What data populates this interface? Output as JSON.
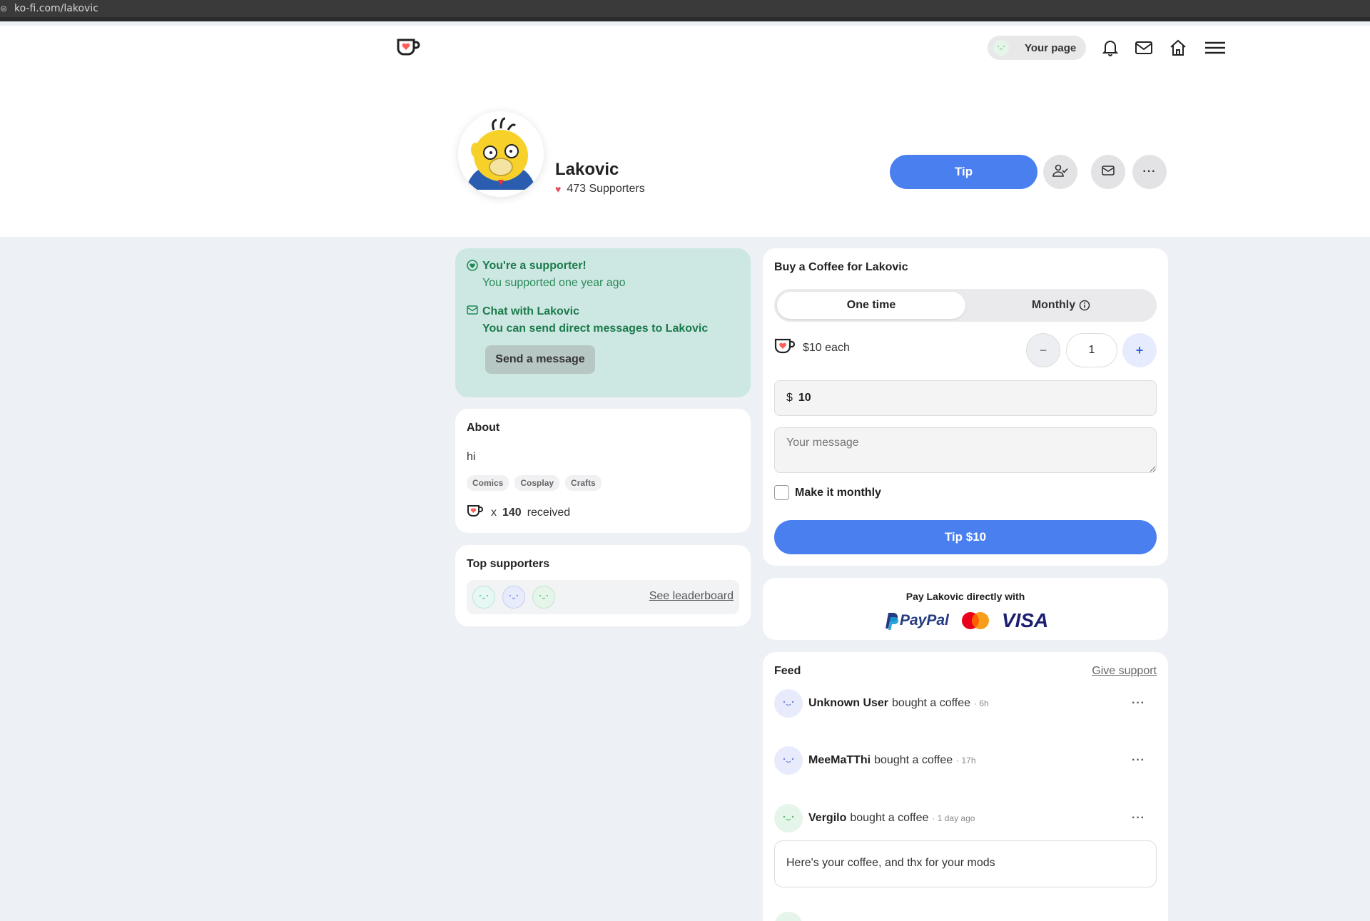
{
  "browser": {
    "url": "ko-fi.com/lakovic"
  },
  "nav": {
    "your_page": "Your page"
  },
  "profile": {
    "name": "Lakovic",
    "supporters": "473 Supporters",
    "tip_label": "Tip"
  },
  "supporter_card": {
    "title": "You're a supporter!",
    "subtitle": "You supported one year ago",
    "chat_title": "Chat with Lakovic",
    "chat_subtitle": "You can send direct messages to Lakovic",
    "send_button": "Send a message"
  },
  "about": {
    "title": "About",
    "text": "hi",
    "tags": [
      "Comics",
      "Cosplay",
      "Crafts"
    ],
    "received_x": "x",
    "received_count": "140",
    "received_label": "received"
  },
  "top_supporters": {
    "title": "Top supporters",
    "leaderboard_link": "See leaderboard"
  },
  "buy": {
    "title": "Buy a Coffee for Lakovic",
    "tab_one_time": "One time",
    "tab_monthly": "Monthly",
    "price_each": "$10 each",
    "minus": "−",
    "quantity": "1",
    "plus": "+",
    "currency": "$",
    "amount": "10",
    "message_placeholder": "Your message",
    "monthly_checkbox": "Make it monthly",
    "tip_button": "Tip $10"
  },
  "pay_direct": {
    "title": "Pay Lakovic directly with",
    "paypal": "PayPal",
    "visa": "VISA"
  },
  "feed": {
    "title": "Feed",
    "give_support": "Give support",
    "items": [
      {
        "name": "Unknown User",
        "action": "bought a coffee",
        "time": "· 6h"
      },
      {
        "name": "MeeMaTThi",
        "action": "bought a coffee",
        "time": "· 17h"
      },
      {
        "name": "Vergilo",
        "action": "bought a coffee",
        "time": "· 1 day ago"
      }
    ],
    "message": "Here's your coffee, and thx for your mods"
  },
  "colors": {
    "accent": "#4a7ff0",
    "supporter_bg": "#cde8e2",
    "supporter_text": "#1c7a4c",
    "background": "#edf0f5"
  }
}
